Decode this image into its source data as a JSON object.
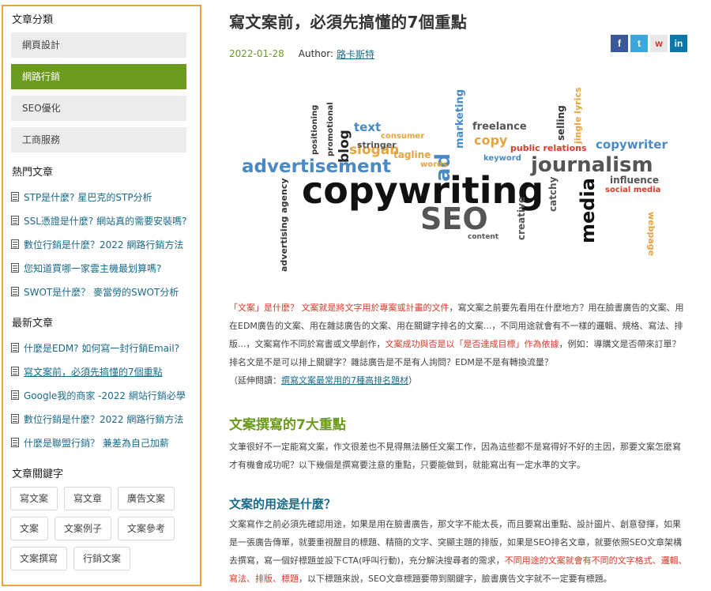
{
  "sidebar": {
    "categories_title": "文章分類",
    "categories": [
      "網頁設計",
      "網路行銷",
      "SEO優化",
      "工商服務"
    ],
    "popular_title": "熱門文章",
    "popular": [
      "STP是什麼? 星巴克的STP分析",
      "SSL憑證是什麼? 網站真的需要安裝嗎?",
      "數位行銷是什麼？2022 網路行銷方法",
      "您知道買哪一家雲主機最划算嗎?",
      "SWOT是什麼？ 麥當勞的SWOT分析"
    ],
    "latest_title": "最新文章",
    "latest": [
      "什麼是EDM? 如何寫一封行銷Email?",
      "寫文案前，必須先搞懂的7個重點",
      "Google我的商家 -2022 網站行銷必學",
      "數位行銷是什麼？2022 網路行銷方法",
      "什麼是聯盟行銷？ 兼差為自己加薪"
    ],
    "keywords_title": "文章關鍵字",
    "keywords": [
      "寫文案",
      "寫文章",
      "廣告文案",
      "文案",
      "文案例子",
      "文案參考",
      "文案撰寫",
      "行銷文案"
    ]
  },
  "article": {
    "title": "寫文案前，必須先搞懂的7個重點",
    "date": "2022-01-28",
    "author_label": "Author:",
    "author": "路卡斯特",
    "share": [
      "f",
      "t",
      "w",
      "in"
    ],
    "cloud_words": [
      "copywriting",
      "SEO",
      "advertisement",
      "journalism",
      "media",
      "ad",
      "blog",
      "copy",
      "slogan",
      "text",
      "freelance",
      "copywriter",
      "marketing",
      "public relations",
      "consumer",
      "tagline",
      "stringer",
      "keyword",
      "influence",
      "catchy",
      "creative",
      "advertising agency",
      "words",
      "selling",
      "jingle lyrics",
      "webpage",
      "social media",
      "promotional",
      "positioning",
      "content"
    ],
    "p1": {
      "a": "「文案」是什麼？ 文案就是將文字用於專案或計畫的文件",
      "b": "，寫文案之前要先看用在什麼地方？用在臉書廣告的文案、用在EDM廣告的文案、用在雜誌廣告的文案、用在關鍵字排名的文案...，不同用途就會有不一樣的邏輯、規格、寫法、排版...，文案寫作不同於寫書或文學創作，",
      "c": "文案成功與否是以「是否達成目標」作為依據",
      "d": "，例如：導購文是否帶來訂單？排名文是不是可以排上關鍵字？雜誌廣告是不是有人詢問？EDM是不是有轉換流量？",
      "e": "（延伸閱讀：",
      "f": "撰寫文案最常用的7種高排名題材",
      "g": "）"
    },
    "h2": "文案撰寫的7大重點",
    "p2": "文筆很好不一定能寫文案，作文很差也不見得無法勝任文案工作，因為這些都不是寫得好不好的主因，那要文案怎麼寫才有機會成功呢？以下幾個是撰寫要注意的重點，只要能做到，就能寫出有一定水準的文字。",
    "h3": "文案的用途是什麼？",
    "p3": {
      "a": "文案寫作之前必須先確認用途，如果是用在臉書廣告，那文字不能太長，而且要寫出重點、設計圖片、創意發揮，如果是一張廣告傳單，就要重視醒目的標題、精簡的文字、突顯主題的排版，如果是SEO排名文章，就要依照SEO文章架構去撰寫，寫一個好標題並設下CTA(呼叫行動)，充分解決搜尋者的需求，",
      "b": "不同用途的文案就會有不同的文字格式、邏輯、寫法、排版、標題",
      "c": "，以下標題來說，SEO文章標題要帶到關鍵字，臉書廣告文字就不一定要有標題。"
    }
  },
  "colors": {
    "accent_green": "#6b9a1e",
    "link_blue": "#1a6a8a",
    "sidebar_border": "#e8a33d",
    "highlight_red": "#d93a2a"
  }
}
